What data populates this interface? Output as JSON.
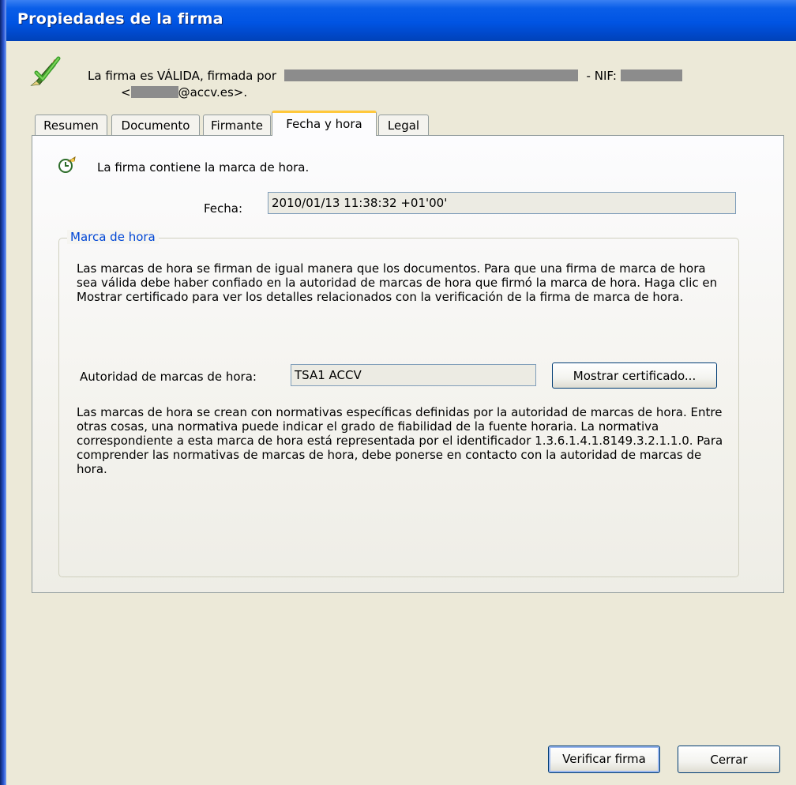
{
  "window": {
    "title": "Propiedades de la firma"
  },
  "header": {
    "status_text": "La firma es VÁLIDA, firmada por",
    "nif_label": "- NIF:",
    "email_prefix": "<",
    "email_suffix": "@accv.es>."
  },
  "tabs": [
    {
      "label": "Resumen",
      "active": false
    },
    {
      "label": "Documento",
      "active": false
    },
    {
      "label": "Firmante",
      "active": false
    },
    {
      "label": "Fecha y hora",
      "active": true
    },
    {
      "label": "Legal",
      "active": false
    }
  ],
  "panel": {
    "timestamp_text": "La firma contiene la marca de hora.",
    "fecha_label": "Fecha:",
    "fecha_value": "2010/01/13 11:38:32 +01'00'",
    "group": {
      "title": "Marca de hora",
      "paragraph1": "Las marcas de hora se firman de igual manera que los documentos. Para que una firma de marca de hora sea válida debe haber confiado en la autoridad de marcas de hora que firmó la marca de hora. Haga clic en Mostrar certificado para ver los detalles relacionados con la verificación de la firma de marca de hora.",
      "tsa_label": "Autoridad de marcas de hora:",
      "tsa_value": "TSA1 ACCV",
      "show_cert_button": "Mostrar certificado...",
      "paragraph2": "Las marcas de hora se crean con normativas específicas definidas por la autoridad de marcas de hora. Entre otras cosas, una normativa puede indicar el grado de fiabilidad de la fuente horaria. La normativa correspondiente a esta marca de hora está representada por el identificador 1.3.6.1.4.1.8149.3.2.1.1.0. Para comprender las normativas de marcas de hora, debe ponerse en contacto con la autoridad de marcas de hora."
    }
  },
  "footer": {
    "verify_button": "Verificar firma",
    "close_button": "Cerrar"
  },
  "icons": {
    "header": "signature-valid-icon",
    "timestamp": "timestamp-icon"
  },
  "colors": {
    "titlebar": "#0054e3",
    "dialog_bg": "#ece9d8",
    "active_tab_accent": "#ffc83c",
    "group_title": "#0046d5"
  }
}
